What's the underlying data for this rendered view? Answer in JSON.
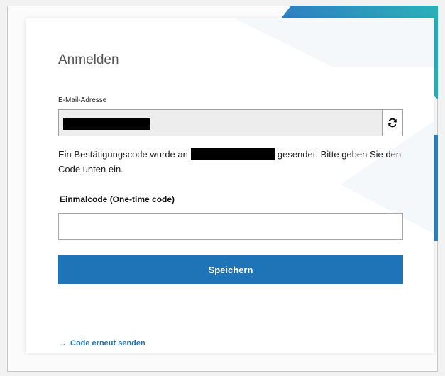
{
  "form": {
    "title": "Anmelden",
    "email_label": "E-Mail-Adresse",
    "info_before": "Ein Bestätigungscode wurde an",
    "info_after": "gesendet. Bitte geben Sie den Code unten ein.",
    "otp_label": "Einmalcode (One-time code)",
    "otp_value": "",
    "save_label": "Speichern",
    "resend_label": "Code erneut senden"
  },
  "icons": {
    "refresh": "refresh-icon",
    "resend_arrow": "arrow-right-icon"
  },
  "colors": {
    "accent": "#1f73b7",
    "email_field_bg": "#ededed",
    "deco_teal": "#2aa3b8",
    "deco_blue": "#2f7fc1"
  }
}
